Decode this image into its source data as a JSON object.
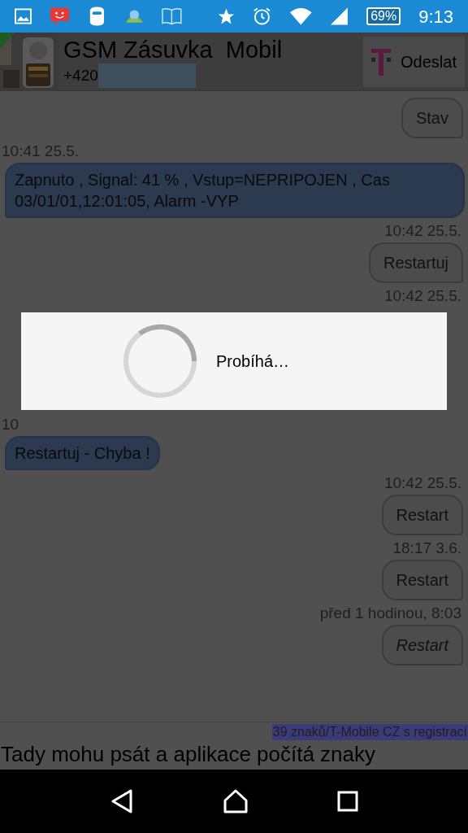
{
  "status_bar": {
    "battery": "69%",
    "time": "9:13"
  },
  "contact": {
    "name": "GSM Zásuvka  Mobil",
    "phone": "+420"
  },
  "send_button": "Odeslat",
  "messages": [
    {
      "kind": "sent",
      "text": "Stav",
      "italic": false
    },
    {
      "kind": "time_left",
      "text": "10:41 25.5."
    },
    {
      "kind": "received",
      "text": "Zapnuto , Signal: 41 % , Vstup=NEPRIPOJEN , Cas 03/01/01,12:01:05, Alarm -VYP"
    },
    {
      "kind": "time_right",
      "text": "10:42 25.5."
    },
    {
      "kind": "sent",
      "text": "Restartuj",
      "italic": false
    },
    {
      "kind": "time_right",
      "text": "10:42 25.5."
    },
    {
      "kind": "dialog",
      "text": "Probíhá…"
    },
    {
      "kind": "time_left",
      "text": "10"
    },
    {
      "kind": "received",
      "text": "Restartuj - Chyba !"
    },
    {
      "kind": "time_right",
      "text": "10:42 25.5."
    },
    {
      "kind": "sent",
      "text": "Restart",
      "italic": false
    },
    {
      "kind": "time_right",
      "text": "18:17 3.6."
    },
    {
      "kind": "sent",
      "text": "Restart",
      "italic": false
    },
    {
      "kind": "time_right",
      "text": "před 1 hodinou, 8:03"
    },
    {
      "kind": "sent",
      "text": "Restart",
      "italic": true
    }
  ],
  "counter": "39 znaků/T-Mobile CZ s registrací",
  "input": {
    "value": "Tady mohu psát a aplikace počítá znaky"
  }
}
